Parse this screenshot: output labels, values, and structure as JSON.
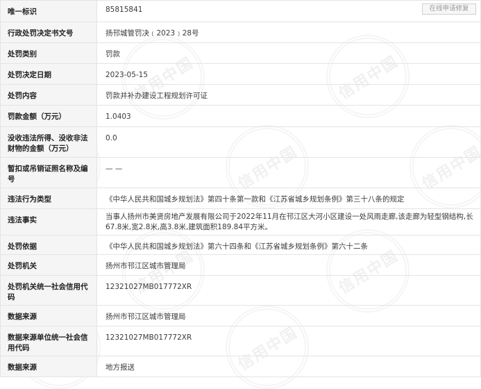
{
  "watermark": "信用中国",
  "repair_button": "在线申请修复",
  "rows": [
    {
      "label": "唯一标识",
      "value": "85815841"
    },
    {
      "label": "行政处罚决定书文号",
      "value": "扬邗城管罚决﹝2023﹞28号"
    },
    {
      "label": "处罚类别",
      "value": "罚款"
    },
    {
      "label": "处罚决定日期",
      "value": "2023-05-15"
    },
    {
      "label": "处罚内容",
      "value": "罚款并补办建设工程规划许可证"
    },
    {
      "label": "罚款金额（万元）",
      "value": "1.0403"
    },
    {
      "label": "没收违法所得、没收非法财物的金额（万元）",
      "value": "0.0"
    },
    {
      "label": "暂扣或吊销证照名称及编号",
      "value": "— —"
    },
    {
      "label": "违法行为类型",
      "value": "《中华人民共和国城乡规划法》第四十条第一款和《江苏省城乡规划条例》第三十八条的规定"
    },
    {
      "label": "违法事实",
      "value": "当事人扬州市美贤房地产发展有限公司于2022年11月在邗江区大河小区建设一处风雨走廊,该走廊为轻型钢结构,长67.8米,宽2.8米,高3.8米,建筑面积189.84平方米。"
    },
    {
      "label": "处罚依据",
      "value": "《中华人民共和国城乡规划法》第六十四条和《江苏省城乡规划条例》第六十二条"
    },
    {
      "label": "处罚机关",
      "value": "扬州市邗江区城市管理局"
    },
    {
      "label": "处罚机关统一社会信用代码",
      "value": "12321027MB017772XR"
    },
    {
      "label": "数据来源",
      "value": "扬州市邗江区城市管理局"
    },
    {
      "label": "数据来源单位统一社会信用代码",
      "value": "12321027MB017772XR"
    },
    {
      "label": "数据来源",
      "value": "地方报送"
    }
  ]
}
